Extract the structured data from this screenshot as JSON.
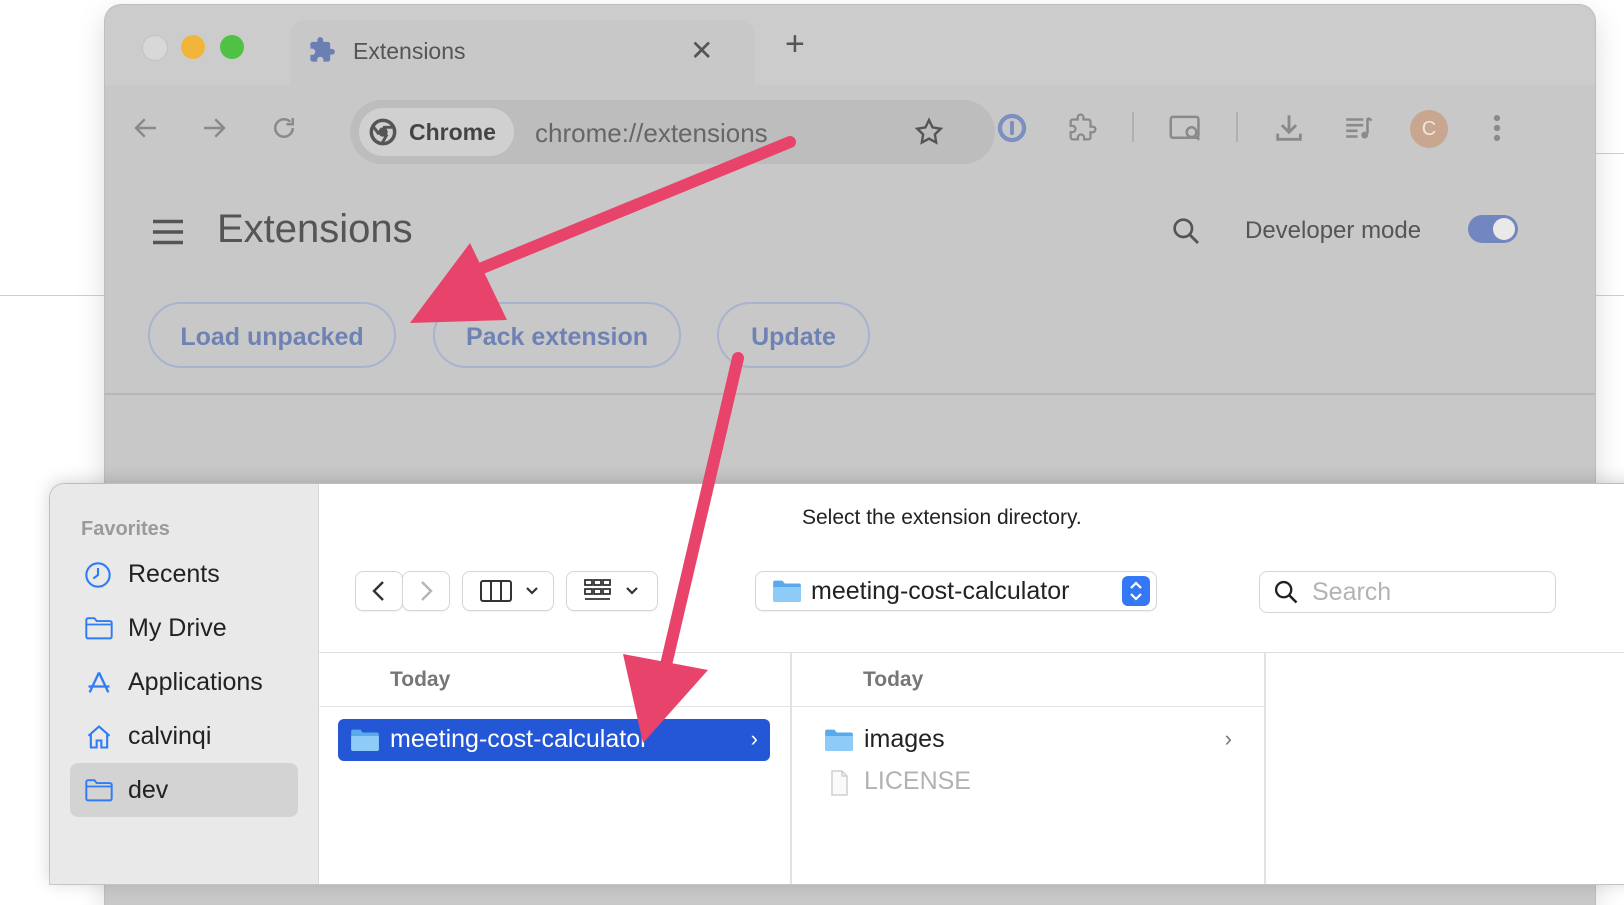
{
  "colors": {
    "accent": "#2457d6",
    "arrow": "#e8436a",
    "toggle": "#7287c0",
    "chrome_pill_text": "#6f82b4"
  },
  "chrome": {
    "tab": {
      "title": "Extensions",
      "icon": "puzzle-icon",
      "close": "✕"
    },
    "new_tab": "+",
    "omnibox": {
      "chip_label": "Chrome",
      "url": "chrome://extensions"
    },
    "avatar_initial": "C"
  },
  "extensions_page": {
    "title": "Extensions",
    "developer_mode_label": "Developer mode",
    "developer_mode_on": true,
    "buttons": {
      "load_unpacked": "Load unpacked",
      "pack_extension": "Pack extension",
      "update": "Update"
    }
  },
  "dialog": {
    "title": "Select the extension directory.",
    "sidebar": {
      "heading": "Favorites",
      "items": [
        {
          "label": "Recents",
          "icon": "clock-icon"
        },
        {
          "label": "My Drive",
          "icon": "folder-icon"
        },
        {
          "label": "Applications",
          "icon": "applications-icon"
        },
        {
          "label": "calvinqi",
          "icon": "home-icon"
        },
        {
          "label": "dev",
          "icon": "folder-icon",
          "selected": true
        }
      ]
    },
    "path_popup": "meeting-cost-calculator",
    "search_placeholder": "Search",
    "columns": [
      {
        "header": "Today",
        "items": [
          {
            "name": "meeting-cost-calculator",
            "type": "folder",
            "selected": true,
            "chevron": "›"
          }
        ]
      },
      {
        "header": "Today",
        "items": [
          {
            "name": "images",
            "type": "folder",
            "chevron": "›"
          },
          {
            "name": "LICENSE",
            "type": "file",
            "disabled": true
          }
        ]
      }
    ]
  }
}
